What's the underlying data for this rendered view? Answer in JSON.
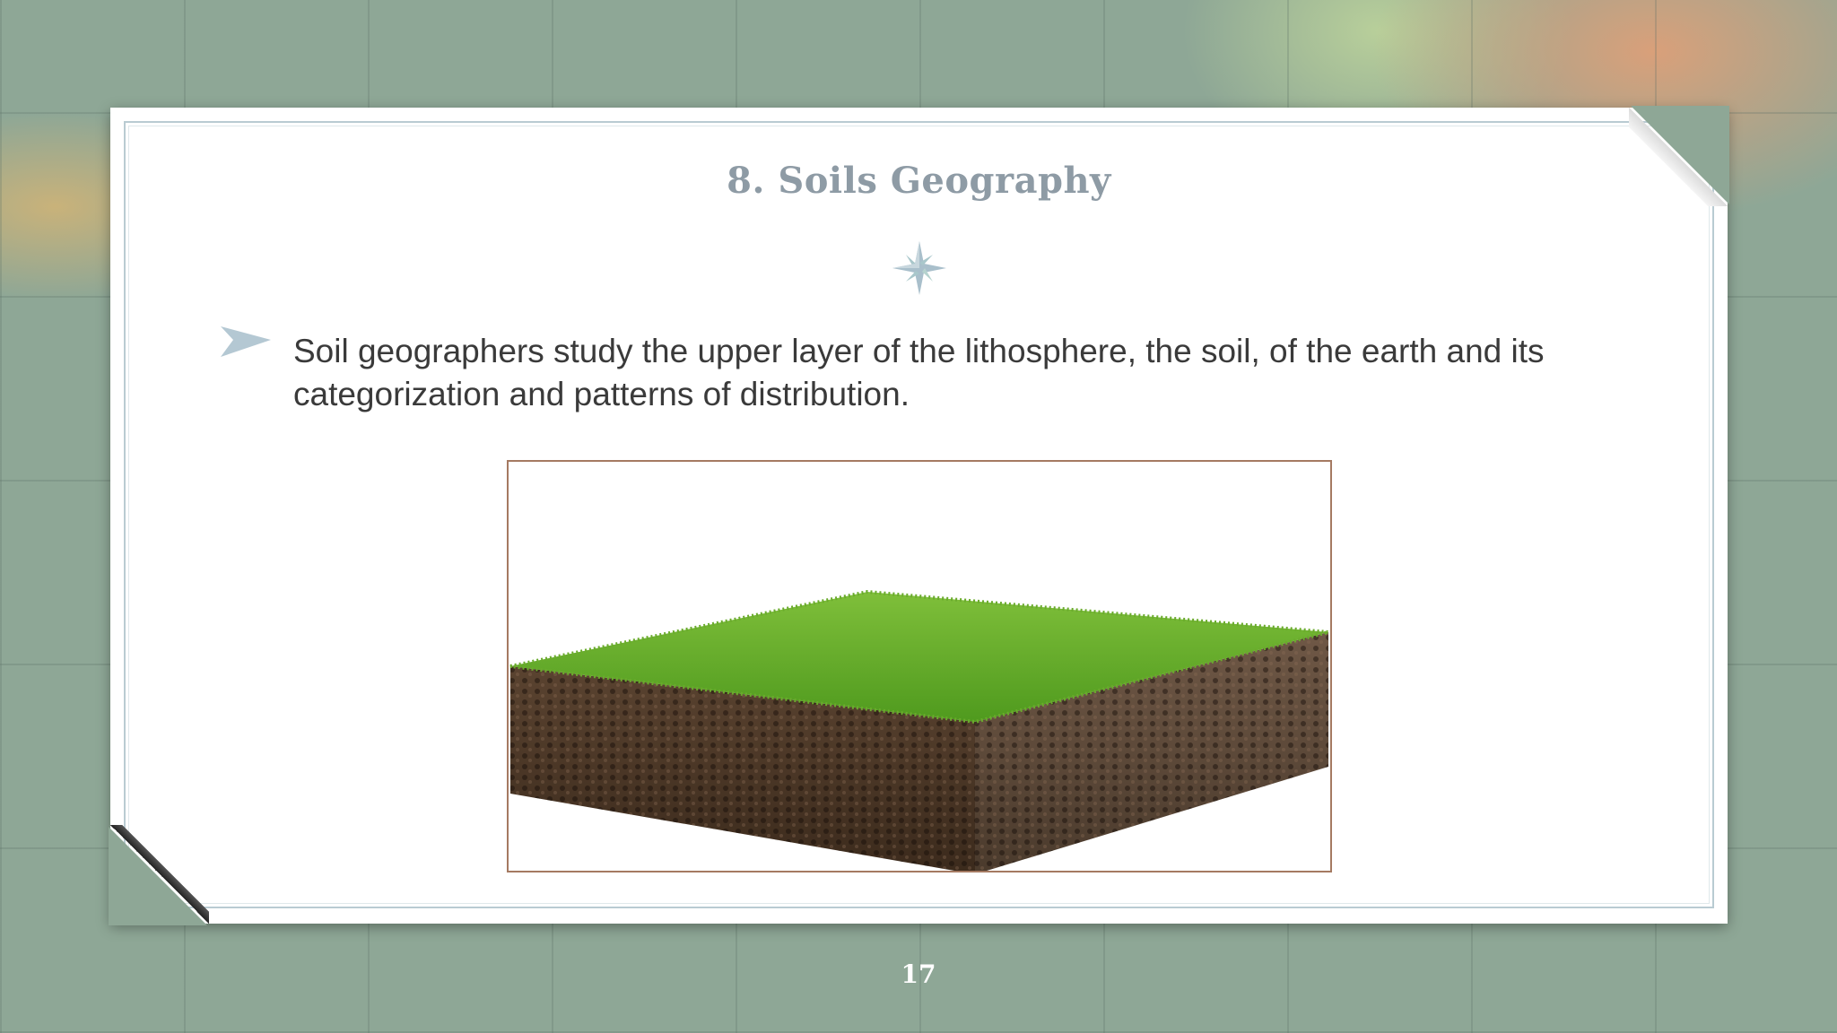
{
  "slide": {
    "title": "8. Soils Geography",
    "bullets": [
      "Soil geographers study the upper layer of the lithosphere, the soil, of the earth and its categorization and patterns of distribution."
    ],
    "image_icon": "soil-cross-section-image",
    "ornament_icon": "compass-star-icon",
    "bullet_icon": "arrow-bullet-icon",
    "page_number": "17"
  },
  "colors": {
    "title": "#8e9ba5",
    "text": "#3a3a3a",
    "accent": "#b9cbd2",
    "background": "#8ea796"
  }
}
